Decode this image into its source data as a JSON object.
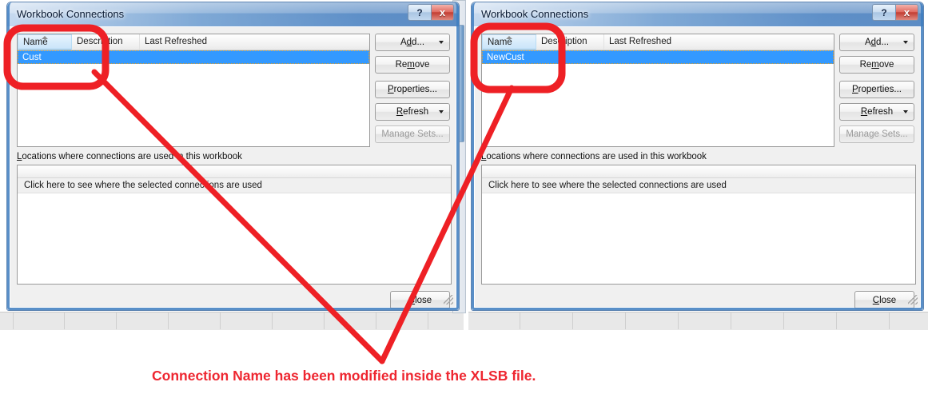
{
  "dialogs": [
    {
      "title": "Workbook Connections",
      "help_label": "?",
      "close_label": "x",
      "columns": [
        "Name",
        "Description",
        "Last Refreshed"
      ],
      "rows": [
        [
          "Cust",
          "",
          ""
        ]
      ],
      "buttons": {
        "add": "Add...",
        "remove": "Remove",
        "properties": "Properties...",
        "refresh": "Refresh",
        "manage_sets": "Manage Sets...",
        "close": "Close"
      },
      "locations_label": "Locations where connections are used in this workbook",
      "locations_hint": "Click here to see where the selected connections are used"
    },
    {
      "title": "Workbook Connections",
      "help_label": "?",
      "close_label": "x",
      "columns": [
        "Name",
        "Description",
        "Last Refreshed"
      ],
      "rows": [
        [
          "NewCust",
          "",
          ""
        ]
      ],
      "buttons": {
        "add": "Add...",
        "remove": "Remove",
        "properties": "Properties...",
        "refresh": "Refresh",
        "manage_sets": "Manage Sets...",
        "close": "Close"
      },
      "locations_label": "Locations where connections are used in this workbook",
      "locations_hint": "Click here to see where the selected connections are used"
    }
  ],
  "annotation": {
    "caption": "Connection Name has been modified inside the XLSB file.",
    "color": "#ee2630",
    "highlight_shape": "rounded-rectangle"
  },
  "colors": {
    "selection_blue": "#3399FF",
    "titlebar_blue": "#2f6db5",
    "annotation_red": "#ee2630",
    "dialog_face": "#f0f0f0"
  }
}
